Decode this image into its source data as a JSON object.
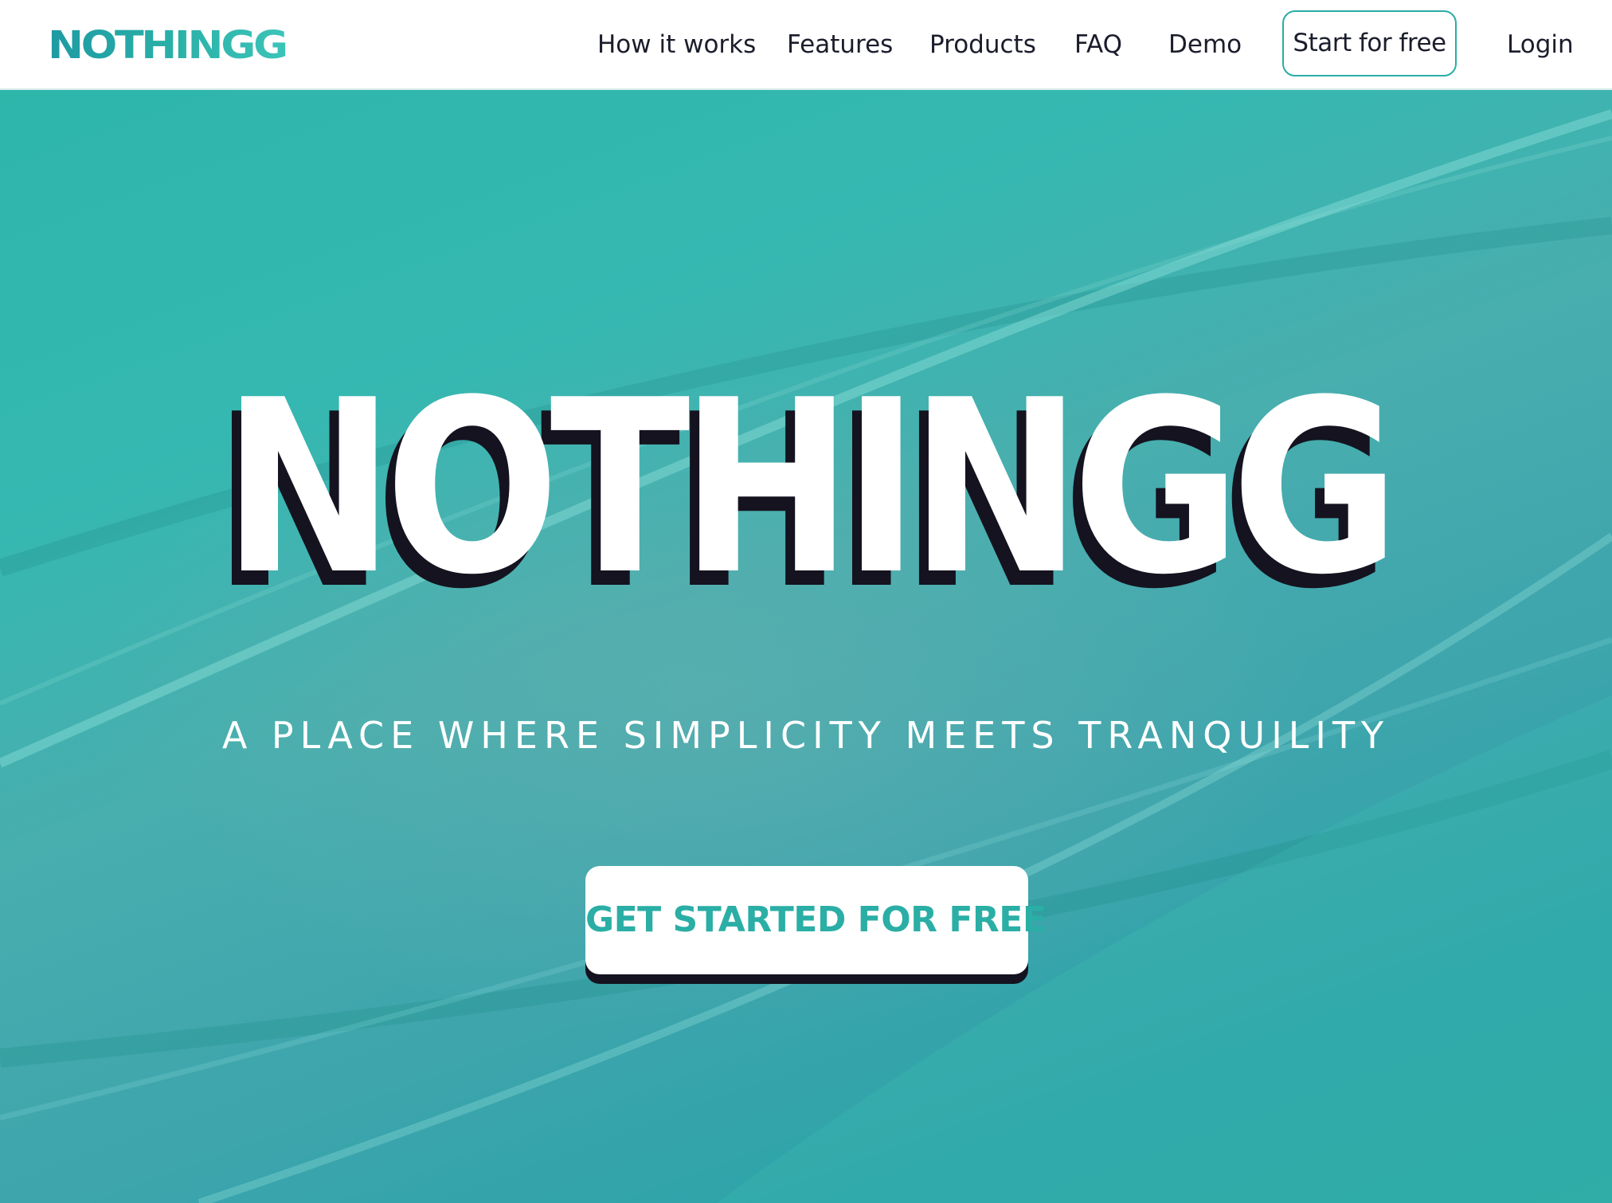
{
  "header": {
    "logo": "NOTHINGG",
    "nav": {
      "how_it_works": "How it works",
      "features": "Features",
      "products": "Products",
      "faq": "FAQ",
      "demo": "Demo",
      "start_for_free": "Start for free",
      "login": "Login"
    }
  },
  "hero": {
    "title": "NOTHINGG",
    "subtitle": "A PLACE WHERE SIMPLICITY MEETS TRANQUILITY",
    "cta_label": "GET STARTED FOR FREE"
  },
  "colors": {
    "brand_teal": "#2aada4",
    "text_dark": "#1b1d2c",
    "shadow_dark": "#14131f",
    "white": "#ffffff"
  }
}
